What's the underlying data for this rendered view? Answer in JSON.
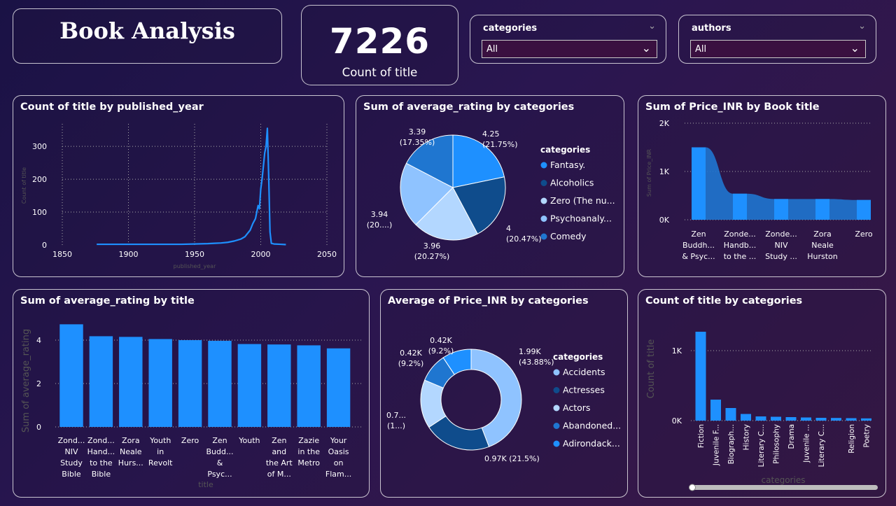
{
  "header": {
    "title": "Book Analysis"
  },
  "kpi": {
    "value": "7226",
    "label": "Count of title"
  },
  "slicers": [
    {
      "label": "categories",
      "selected": "All"
    },
    {
      "label": "authors",
      "selected": "All"
    }
  ],
  "colors": {
    "primary": "#1e90ff",
    "dark": "#0f4c8c",
    "light": "#8fc3ff",
    "lightest": "#b3d7ff",
    "mid": "#1f76d0"
  },
  "chart_data": [
    {
      "id": "year_line",
      "type": "line",
      "title": "Count of title by published_year",
      "xlabel": "published_year",
      "ylabel": "Count of title",
      "xlim": [
        1850,
        2050
      ],
      "ylim": [
        0,
        360
      ],
      "xticks": [
        "1850",
        "1900",
        "1950",
        "2000",
        "2050"
      ],
      "yticks": [
        "0",
        "100",
        "200",
        "300"
      ],
      "x": [
        1876,
        1900,
        1920,
        1940,
        1950,
        1960,
        1965,
        1970,
        1975,
        1980,
        1985,
        1988,
        1990,
        1992,
        1994,
        1996,
        1998,
        1999,
        2000,
        2001,
        2002,
        2003,
        2004,
        2005,
        2006,
        2007,
        2008,
        2010,
        2015,
        2019
      ],
      "y": [
        2,
        2,
        2,
        2,
        3,
        4,
        5,
        6,
        8,
        12,
        18,
        25,
        35,
        45,
        65,
        80,
        120,
        110,
        170,
        200,
        240,
        280,
        300,
        355,
        210,
        40,
        5,
        3,
        2,
        1
      ],
      "grid": true
    },
    {
      "id": "rating_pie",
      "type": "pie",
      "title": "Sum of average_rating by categories",
      "legend_title": "categories",
      "legend_position": "right",
      "labels": [
        "Fantasy.",
        "Alcoholics",
        "Zero (The nu...",
        "Psychoanaly...",
        "Comedy"
      ],
      "values": [
        4.25,
        4,
        3.96,
        3.94,
        3.39
      ],
      "data_labels": [
        [
          "4.25",
          "(21.75%)"
        ],
        [
          "4",
          "(20.47%)"
        ],
        [
          "3.96",
          "(20.27%)"
        ],
        [
          "3.94",
          "(20....)"
        ],
        [
          "3.39",
          "(17.35%)"
        ]
      ],
      "colors": [
        "#1e90ff",
        "#0f4c8c",
        "#b3d7ff",
        "#8fc3ff",
        "#1f76d0"
      ]
    },
    {
      "id": "price_area",
      "type": "area",
      "title": "Sum of Price_INR by Book title",
      "ylabel": "Sum of Price_INR",
      "yticks": [
        "0K",
        "1K",
        "2K"
      ],
      "ylim": [
        0,
        2000
      ],
      "categories": [
        [
          "Zen",
          "Buddh...",
          "& Psyc..."
        ],
        [
          "Zonde...",
          "Handb...",
          "to the ..."
        ],
        [
          "Zonde...",
          "NIV",
          "Study ..."
        ],
        [
          "Zora",
          "Neale",
          "Hurston"
        ],
        [
          "Zero"
        ]
      ],
      "values": [
        1500,
        540,
        430,
        430,
        410
      ],
      "grid": true
    },
    {
      "id": "rating_bar",
      "type": "bar",
      "title": "Sum of average_rating by title",
      "xlabel": "title",
      "ylabel": "Sum of average_rating",
      "yticks": [
        "0",
        "2",
        "4"
      ],
      "ylim": [
        0,
        5
      ],
      "categories": [
        [
          "Zond...",
          "NIV",
          "Study",
          "Bible"
        ],
        [
          "Zond...",
          "Hand...",
          "to the",
          "Bible"
        ],
        [
          "Zora",
          "Neale",
          "Hurs..."
        ],
        [
          "Youth",
          "in",
          "Revolt"
        ],
        [
          "Zero"
        ],
        [
          "Zen",
          "Budd...",
          "&",
          "Psyc..."
        ],
        [
          "Youth"
        ],
        [
          "Zen",
          "and",
          "the Art",
          "of M..."
        ],
        [
          "Zazie",
          "in the",
          "Metro"
        ],
        [
          "Your",
          "Oasis",
          "on",
          "Flam..."
        ]
      ],
      "values": [
        4.73,
        4.18,
        4.15,
        4.05,
        4.0,
        3.97,
        3.82,
        3.8,
        3.76,
        3.62
      ],
      "grid": true
    },
    {
      "id": "price_donut",
      "type": "pie",
      "title": "Average of Price_INR by categories",
      "legend_title": "categories",
      "legend_position": "right",
      "labels": [
        "Accidents",
        "Actresses",
        "Actors",
        "Abandoned...",
        "Adirondack..."
      ],
      "values": [
        1.99,
        0.97,
        0.7,
        0.42,
        0.42
      ],
      "data_labels": [
        [
          "1.99K",
          "(43.88%)"
        ],
        [
          "0.97K (21.5%)"
        ],
        [
          "0.7...",
          "(1...)"
        ],
        [
          "0.42K",
          "(9.2%)"
        ],
        [
          "0.42K",
          "(9.2%)"
        ]
      ],
      "colors": [
        "#8fc3ff",
        "#0f4c8c",
        "#b3d7ff",
        "#1f76d0",
        "#1e90ff"
      ]
    },
    {
      "id": "count_bar",
      "type": "bar",
      "title": "Count of title by categories",
      "xlabel": "categories",
      "ylabel": "Count of title",
      "yticks": [
        "0K",
        "1K"
      ],
      "ylim": [
        0,
        1400
      ],
      "categories": [
        "Fiction",
        "Juvenile F...",
        "Biograph...",
        "History",
        "Literary C...",
        "Philosophy",
        "Drama",
        "Juvenile ...",
        "Literary C...",
        "",
        "Religion",
        "Poetry"
      ],
      "values": [
        1270,
        300,
        180,
        95,
        60,
        55,
        50,
        45,
        40,
        38,
        35,
        32
      ]
    }
  ]
}
